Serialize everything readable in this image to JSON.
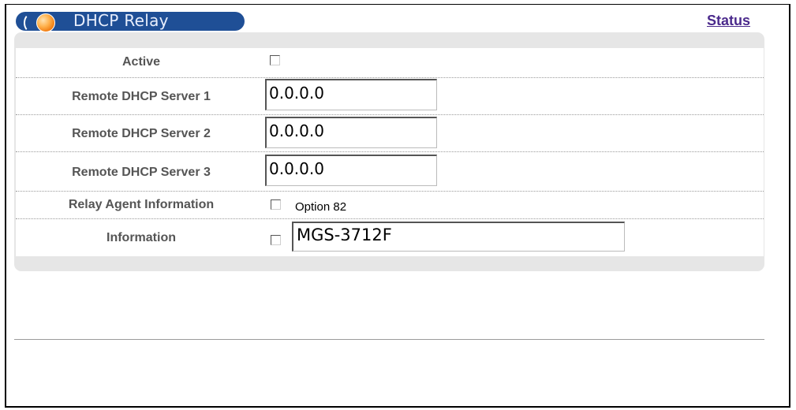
{
  "header": {
    "title": "DHCP Relay",
    "status_link": "Status",
    "title_bar_color": "#1f4f96",
    "orb_icon": "orange-orb-icon"
  },
  "form": {
    "active": {
      "label": "Active",
      "checked": false
    },
    "servers": [
      {
        "label": "Remote DHCP Server 1",
        "value": "0.0.0.0"
      },
      {
        "label": "Remote DHCP Server 2",
        "value": "0.0.0.0"
      },
      {
        "label": "Remote DHCP Server 3",
        "value": "0.0.0.0"
      }
    ],
    "relay_agent": {
      "label": "Relay Agent Information",
      "option_label": "Option 82",
      "checked": false
    },
    "information": {
      "label": "Information",
      "checked": false,
      "value": "MGS-3712F"
    }
  }
}
